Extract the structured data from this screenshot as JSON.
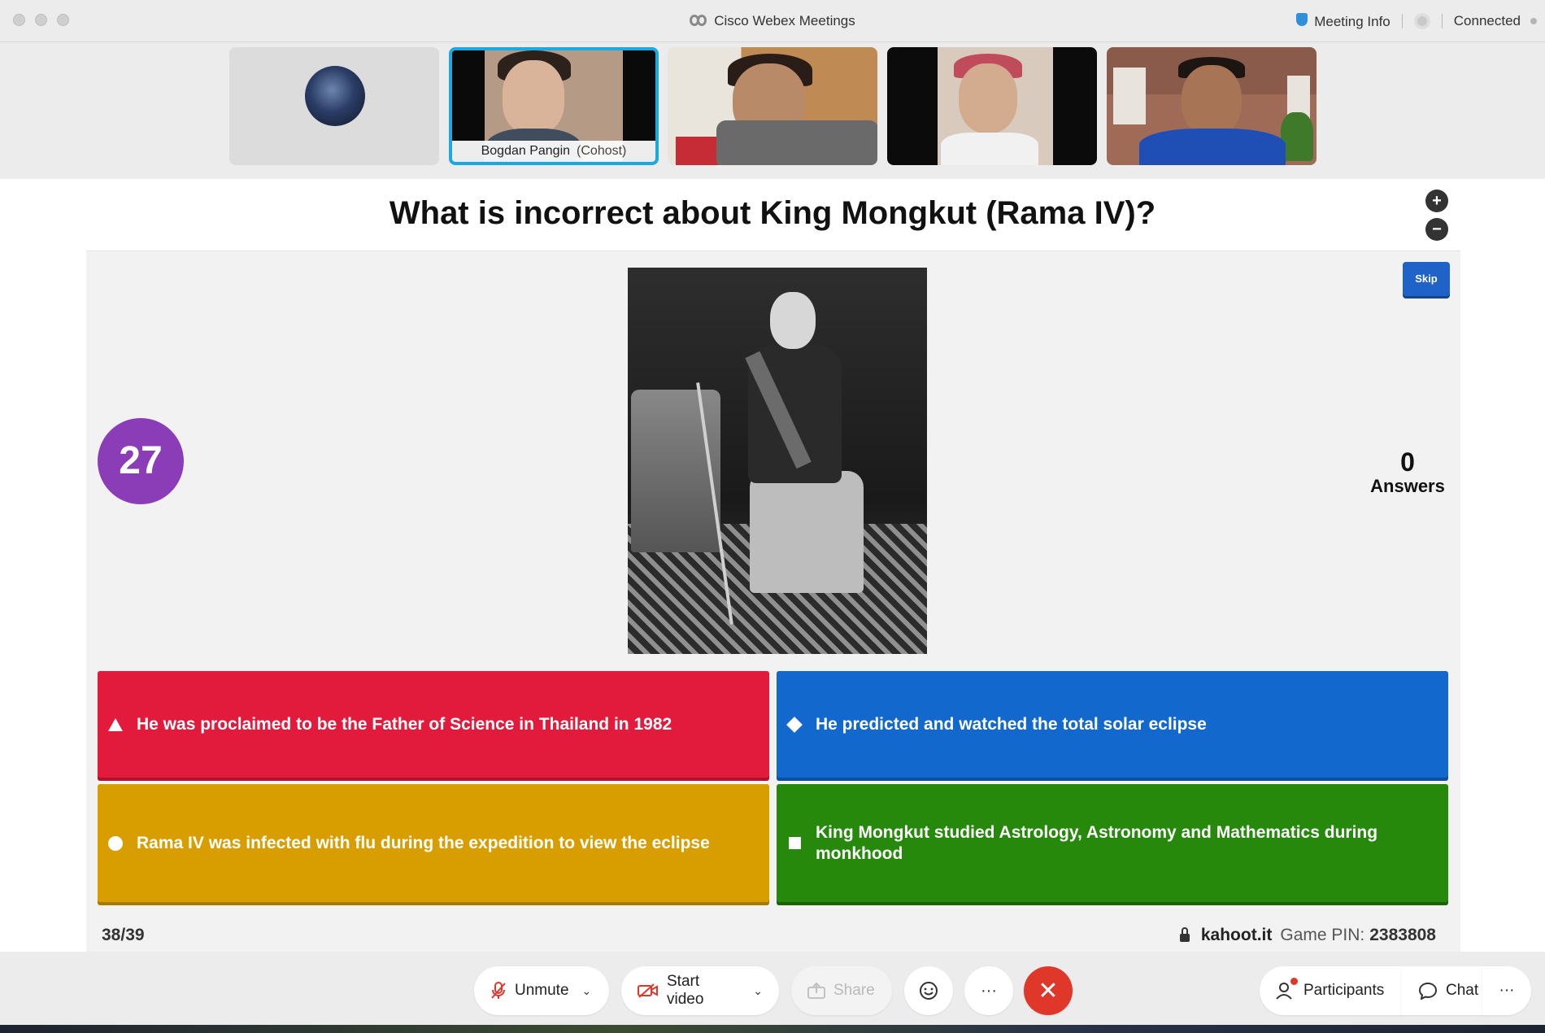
{
  "window": {
    "title": "Cisco Webex Meetings",
    "meeting_info": "Meeting Info",
    "status": "Connected"
  },
  "participants": [
    {
      "type": "avatar"
    },
    {
      "type": "video",
      "name": "Bogdan Pangin",
      "role": "(Cohost)",
      "active": true
    },
    {
      "type": "video"
    },
    {
      "type": "video"
    },
    {
      "type": "video"
    }
  ],
  "quiz": {
    "question": "What is incorrect about King Mongkut (Rama IV)?",
    "skip_label": "Skip",
    "timer": "27",
    "answers_count": "0",
    "answers_label": "Answers",
    "options": [
      {
        "shape": "triangle",
        "color": "#e21b3c",
        "text": "He was proclaimed to be the Father of Science in Thailand in 1982"
      },
      {
        "shape": "diamond",
        "color": "#1368ce",
        "text": "He predicted and watched the total solar eclipse"
      },
      {
        "shape": "circle",
        "color": "#d89e00",
        "text": "Rama IV was infected with flu during the expedition to view the eclipse"
      },
      {
        "shape": "square",
        "color": "#26890c",
        "text": "King Mongkut studied Astrology, Astronomy and Mathematics during monkhood"
      }
    ],
    "progress": "38/39",
    "site": "kahoot.it",
    "pin_label": "Game PIN:",
    "pin": "2383808"
  },
  "controls": {
    "unmute": "Unmute",
    "start_video": "Start video",
    "share": "Share",
    "more": "···",
    "participants": "Participants",
    "chat": "Chat"
  },
  "icons": [
    "cisco-logo-icon",
    "shield-icon",
    "record-icon",
    "zoom-in-icon",
    "zoom-out-icon",
    "lock-icon",
    "muted-mic-icon",
    "video-off-icon",
    "share-icon",
    "reaction-icon",
    "more-icon",
    "end-call-icon",
    "participants-icon",
    "chat-icon"
  ]
}
